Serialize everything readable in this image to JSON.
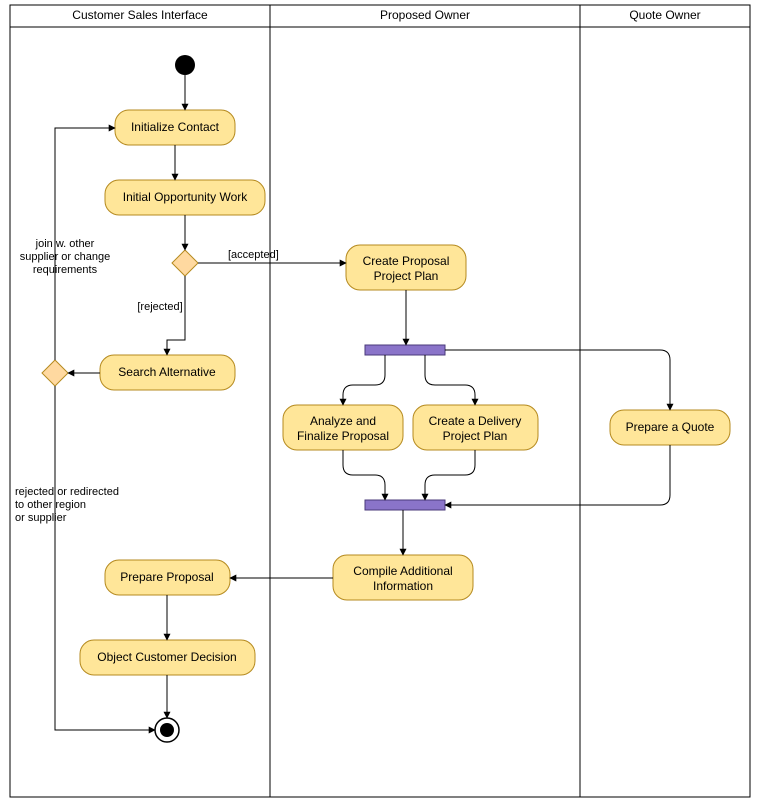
{
  "lanes": {
    "l1": "Customer Sales Interface",
    "l2": "Proposed Owner",
    "l3": "Quote Owner"
  },
  "activities": {
    "init_contact": "Initialize Contact",
    "initial_opp": "Initial Opportunity Work",
    "search_alt": "Search Alternative",
    "create_plan_l1": "Create Proposal",
    "create_plan_l2": "Project Plan",
    "analyze_l1": "Analyze and",
    "analyze_l2": "Finalize Proposal",
    "delivery_l1": "Create a Delivery",
    "delivery_l2": "Project Plan",
    "quote": "Prepare a Quote",
    "compile_l1": "Compile Additional",
    "compile_l2": "Information",
    "prepare_proposal": "Prepare Proposal",
    "object_decision": "Object Customer Decision"
  },
  "labels": {
    "accepted": "[accepted]",
    "rejected": "[rejected]",
    "join_l1": "join w. other",
    "join_l2": "supplier or change",
    "join_l3": "requirements",
    "redirect_l1": "rejected or redirected",
    "redirect_l2": "to other region",
    "redirect_l3": "or supplier"
  }
}
